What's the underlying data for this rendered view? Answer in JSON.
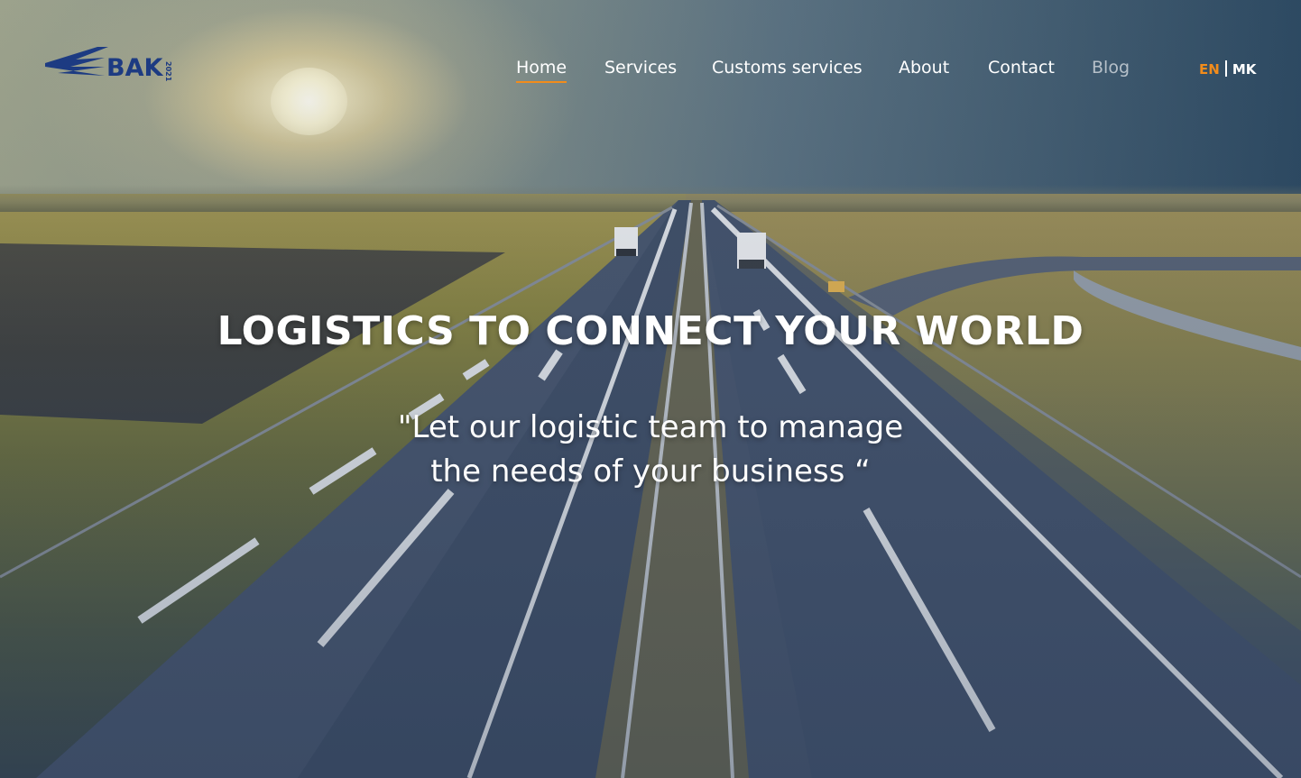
{
  "brand": {
    "name": "BAK",
    "year": "2021",
    "logo_color": "#1d3b82"
  },
  "nav": {
    "items": [
      {
        "label": "Home",
        "active": true
      },
      {
        "label": "Services",
        "active": false
      },
      {
        "label": "Customs services",
        "active": false
      },
      {
        "label": "About",
        "active": false
      },
      {
        "label": "Contact",
        "active": false
      },
      {
        "label": "Blog",
        "active": false
      }
    ],
    "accent_color": "#f28c1b"
  },
  "language": {
    "current": "EN",
    "other": "MK"
  },
  "hero": {
    "title": "LOGISTICS TO CONNECT YOUR WORLD",
    "quote_line_1": "\"Let our logistic team to manage",
    "quote_line_2": "the needs of your business “"
  }
}
